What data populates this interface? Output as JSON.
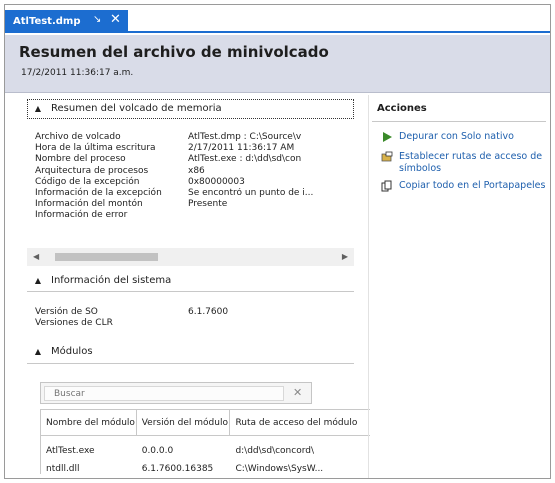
{
  "tab": {
    "title": "AtlTest.dmp",
    "pin_glyph": "↘",
    "close_glyph": "✕"
  },
  "header": {
    "title": "Resumen del archivo de minivolcado",
    "date": "17/2/2011 11:36:17 a.m."
  },
  "dump_section": {
    "title": "Resumen del volcado de memoria",
    "rows": [
      {
        "key": "Archivo de volcado",
        "value": "AtlTest.dmp : C:\\Source\\v"
      },
      {
        "key": "Hora de la última escritura",
        "value": "2/17/2011 11:36:17 AM"
      },
      {
        "key": "Nombre del proceso",
        "value": "AtlTest.exe : d:\\dd\\sd\\con"
      },
      {
        "key": "Arquitectura de procesos",
        "value": "x86"
      },
      {
        "key": "Código de la excepción",
        "value": "0x80000003"
      },
      {
        "key": "Información de la excepción",
        "value": "Se encontró un punto de i..."
      },
      {
        "key": "Información del montón",
        "value": "Presente"
      },
      {
        "key": "Información de error",
        "value": ""
      }
    ]
  },
  "system_section": {
    "title": "Información del sistema",
    "rows": [
      {
        "key": "Versión de SO",
        "value": "6.1.7600"
      },
      {
        "key": "Versiones de CLR",
        "value": ""
      }
    ]
  },
  "modules_section": {
    "title": "Módulos",
    "search_placeholder": "Buscar",
    "clear_glyph": "✕",
    "columns": [
      "Nombre del módulo",
      "Versión del módulo",
      "Ruta de acceso del módulo"
    ],
    "rows": [
      [
        "AtlTest.exe",
        "0.0.0.0",
        "d:\\dd\\sd\\concord\\"
      ],
      [
        "ntdll.dll",
        "6.1.7600.16385",
        "C:\\Windows\\SysW..."
      ]
    ]
  },
  "actions": {
    "title": "Acciones",
    "items": [
      {
        "label": "Depurar con Solo nativo",
        "icon": "play-icon"
      },
      {
        "label": "Establecer rutas de acceso de símbolos",
        "icon": "folder-icon"
      },
      {
        "label": "Copiar todo en el Portapapeles",
        "icon": "copy-icon"
      }
    ]
  },
  "colors": {
    "accent": "#1c6dd0",
    "header_bg": "#d9dce8",
    "link": "#1e5fad",
    "play": "#3a8a2a"
  }
}
